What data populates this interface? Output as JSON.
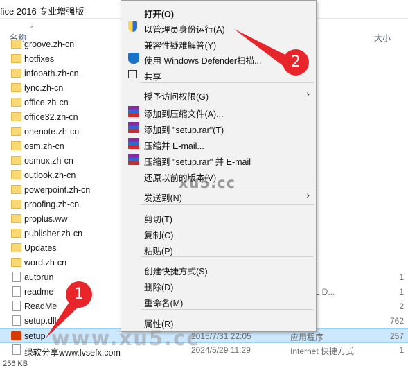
{
  "window": {
    "title": "fice 2016 专业增强版"
  },
  "columns": {
    "name": "名称",
    "size": "大小"
  },
  "files": [
    {
      "name": "groove.zh-cn",
      "icon": "folder",
      "date": "",
      "type": "",
      "size": ""
    },
    {
      "name": "hotfixes",
      "icon": "folder",
      "date": "",
      "type": "",
      "size": ""
    },
    {
      "name": "infopath.zh-cn",
      "icon": "folder",
      "date": "",
      "type": "",
      "size": ""
    },
    {
      "name": "lync.zh-cn",
      "icon": "folder",
      "date": "",
      "type": "",
      "size": ""
    },
    {
      "name": "office.zh-cn",
      "icon": "folder",
      "date": "",
      "type": "",
      "size": ""
    },
    {
      "name": "office32.zh-cn",
      "icon": "folder",
      "date": "",
      "type": "",
      "size": ""
    },
    {
      "name": "onenote.zh-cn",
      "icon": "folder",
      "date": "",
      "type": "",
      "size": ""
    },
    {
      "name": "osm.zh-cn",
      "icon": "folder",
      "date": "",
      "type": "",
      "size": ""
    },
    {
      "name": "osmux.zh-cn",
      "icon": "folder",
      "date": "",
      "type": "",
      "size": ""
    },
    {
      "name": "outlook.zh-cn",
      "icon": "folder",
      "date": "",
      "type": "",
      "size": ""
    },
    {
      "name": "powerpoint.zh-cn",
      "icon": "folder",
      "date": "",
      "type": "",
      "size": ""
    },
    {
      "name": "proofing.zh-cn",
      "icon": "folder",
      "date": "",
      "type": "",
      "size": ""
    },
    {
      "name": "proplus.ww",
      "icon": "folder",
      "date": "",
      "type": "",
      "size": ""
    },
    {
      "name": "publisher.zh-cn",
      "icon": "folder",
      "date": "",
      "type": "",
      "size": ""
    },
    {
      "name": "Updates",
      "icon": "folder",
      "date": "",
      "type": "",
      "size": ""
    },
    {
      "name": "word.zh-cn",
      "icon": "folder",
      "date": "",
      "type": "",
      "size": ""
    },
    {
      "name": "autorun",
      "icon": "file",
      "date": "",
      "type": "",
      "size": "1"
    },
    {
      "name": "readme",
      "icon": "file",
      "date": "",
      "type": "e HTML D...",
      "size": "1"
    },
    {
      "name": "ReadMe",
      "icon": "file",
      "date": "",
      "type": "当",
      "size": "2"
    },
    {
      "name": "setup.dll",
      "icon": "file",
      "date": "",
      "type": "序扩展",
      "size": "762"
    },
    {
      "name": "setup",
      "icon": "office",
      "date": "2015/7/31 22:05",
      "type": "应用程序",
      "size": "257"
    },
    {
      "name": "绿软分享www.lvsefx.com",
      "icon": "file",
      "date": "2024/5/29 11:29",
      "type": "Internet 快捷方式",
      "size": "1"
    }
  ],
  "status": "256 KB",
  "context_menu": {
    "items": [
      {
        "label": "打开(O)",
        "bold": true,
        "icon": ""
      },
      {
        "label": "以管理员身份运行(A)",
        "icon": "shield-icon"
      },
      {
        "label": "兼容性疑难解答(Y)",
        "icon": ""
      },
      {
        "label": "使用 Windows Defender扫描...",
        "icon": "defender-icon"
      },
      {
        "label": "共享",
        "icon": "share-icon"
      },
      {
        "label": "授予访问权限(G)",
        "icon": "",
        "arrow": true
      },
      {
        "label": "添加到压缩文件(A)...",
        "icon": "winrar-icon"
      },
      {
        "label": "添加到 \"setup.rar\"(T)",
        "icon": "winrar-icon"
      },
      {
        "label": "压缩并 E-mail...",
        "icon": "winrar-icon"
      },
      {
        "label": "压缩到 \"setup.rar\" 并 E-mail",
        "icon": "winrar-icon"
      },
      {
        "label": "还原以前的版本(V)",
        "icon": ""
      },
      {
        "label": "发送到(N)",
        "icon": "",
        "arrow": true
      },
      {
        "label": "剪切(T)",
        "icon": ""
      },
      {
        "label": "复制(C)",
        "icon": ""
      },
      {
        "label": "粘贴(P)",
        "icon": ""
      },
      {
        "label": "创建快捷方式(S)",
        "icon": ""
      },
      {
        "label": "删除(D)",
        "icon": ""
      },
      {
        "label": "重命名(M)",
        "icon": ""
      },
      {
        "label": "属性(R)",
        "icon": ""
      }
    ],
    "arrow_glyph": "›"
  },
  "annotations": {
    "badge1": "1",
    "badge2": "2",
    "accent": "#e8252a"
  },
  "watermarks": {
    "menu": "xu5.cc",
    "bottom": "www.xu5.cc"
  }
}
